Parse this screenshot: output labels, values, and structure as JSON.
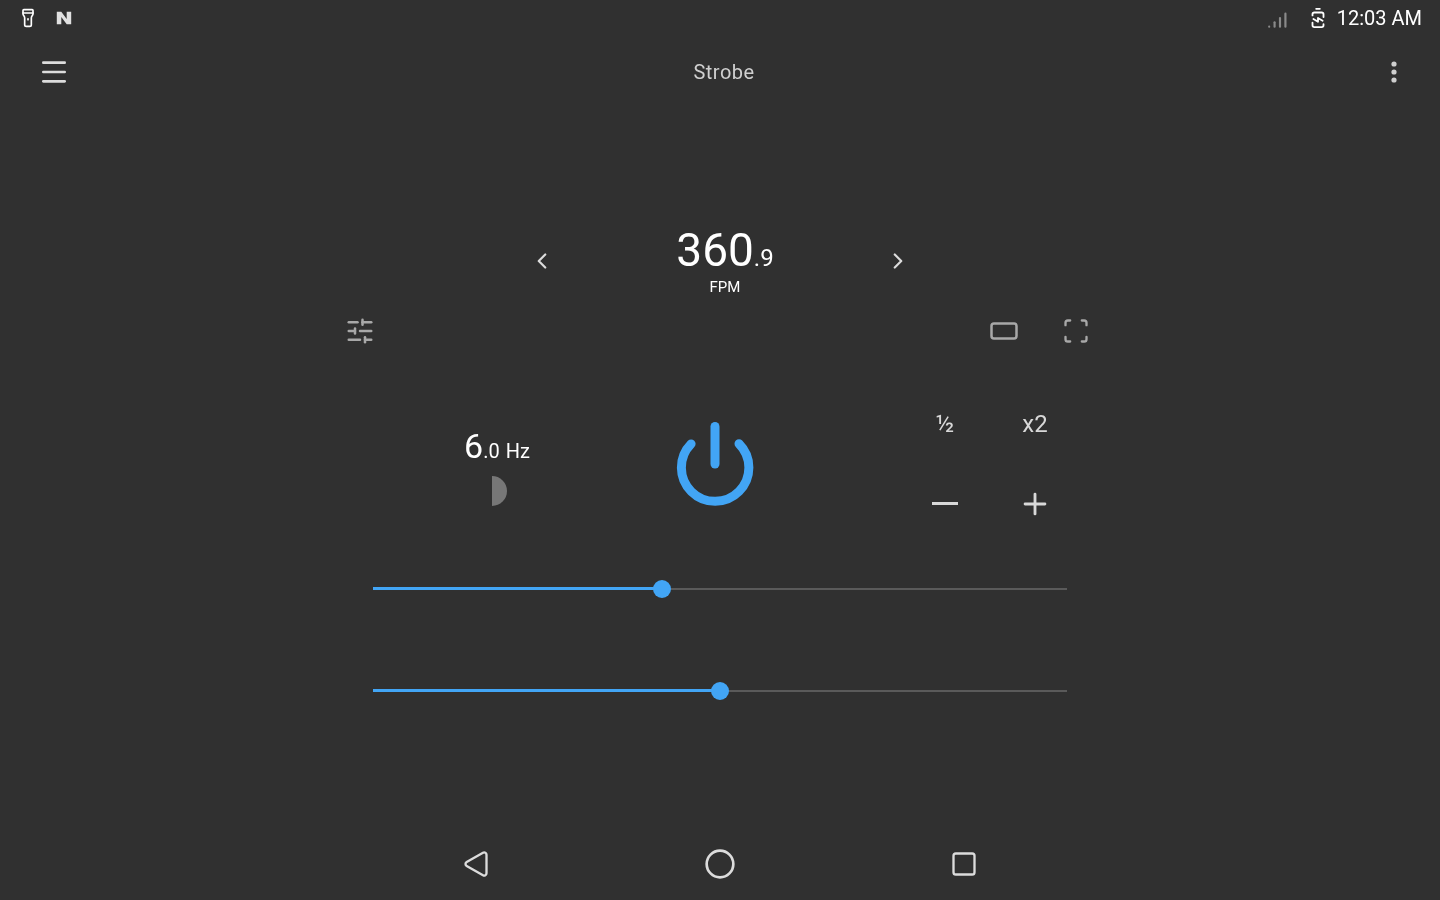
{
  "status_bar": {
    "time": "12:03 AM"
  },
  "toolbar": {
    "title": "Strobe"
  },
  "rate": {
    "whole": "360",
    "fraction": ".9",
    "unit": "FPM"
  },
  "frequency": {
    "whole": "6",
    "fraction": ".0",
    "unit": "Hz"
  },
  "multipliers": [
    "½",
    "x2"
  ],
  "sliders": [
    {
      "level": 0.417
    },
    {
      "level": 0.5
    }
  ]
}
